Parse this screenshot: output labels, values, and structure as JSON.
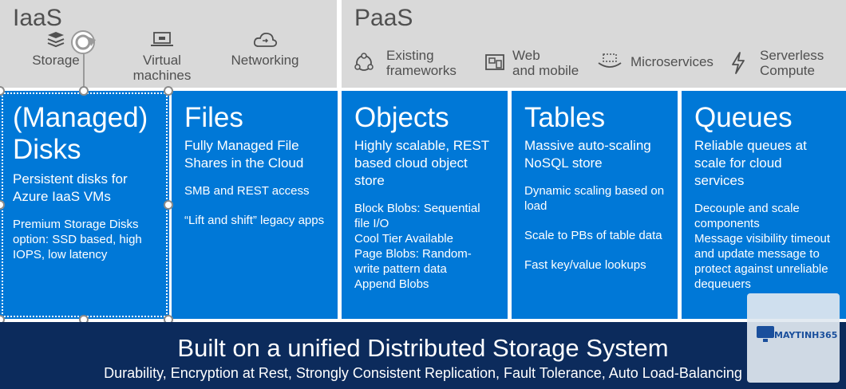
{
  "iaas": {
    "title": "IaaS",
    "items": [
      {
        "label": "Storage",
        "icon": "storage-stack-icon"
      },
      {
        "label": "Virtual\nmachines",
        "icon": "laptop-icon"
      },
      {
        "label": "Networking",
        "icon": "cloud-network-icon"
      }
    ]
  },
  "paas": {
    "title": "PaaS",
    "items": [
      {
        "label": "Existing\nframeworks",
        "icon": "frameworks-icon"
      },
      {
        "label": "Web\nand mobile",
        "icon": "web-mobile-icon"
      },
      {
        "label": "Microservices",
        "icon": "microservices-icon"
      },
      {
        "label": "Serverless\nCompute",
        "icon": "lightning-icon"
      }
    ]
  },
  "cards": [
    {
      "title": "(Managed) Disks",
      "subtitle": "Persistent disks for Azure IaaS VMs",
      "body": [
        "Premium Storage Disks option: SSD based, high IOPS, low latency"
      ]
    },
    {
      "title": "Files",
      "subtitle": "Fully Managed File Shares in the Cloud",
      "body": [
        "SMB and REST access",
        "“Lift and shift” legacy apps"
      ]
    },
    {
      "title": "Objects",
      "subtitle": "Highly scalable, REST based cloud object store",
      "body": [
        "Block Blobs: Sequential file I/O\nCool Tier Available\nPage Blobs: Random-write pattern data\nAppend Blobs"
      ]
    },
    {
      "title": "Tables",
      "subtitle": "Massive auto-scaling NoSQL store",
      "body": [
        "Dynamic scaling based on load",
        "Scale to PBs of table data",
        "Fast key/value lookups"
      ]
    },
    {
      "title": "Queues",
      "subtitle": "Reliable queues at scale for cloud services",
      "body": [
        "Decouple and scale components\nMessage visibility timeout and update message to protect against unreliable dequeuers"
      ]
    }
  ],
  "footer": {
    "title": "Built on a unified Distributed Storage System",
    "subtitle": "Durability, Encryption at Rest, Strongly Consistent Replication, Fault Tolerance, Auto Load-Balancing"
  },
  "watermark": {
    "text": "MAYTINH365"
  },
  "colors": {
    "header_bg": "#d9d9d9",
    "card_bg": "#0078d7",
    "footer_bg": "#0c2b5c",
    "text_gray": "#505050"
  }
}
